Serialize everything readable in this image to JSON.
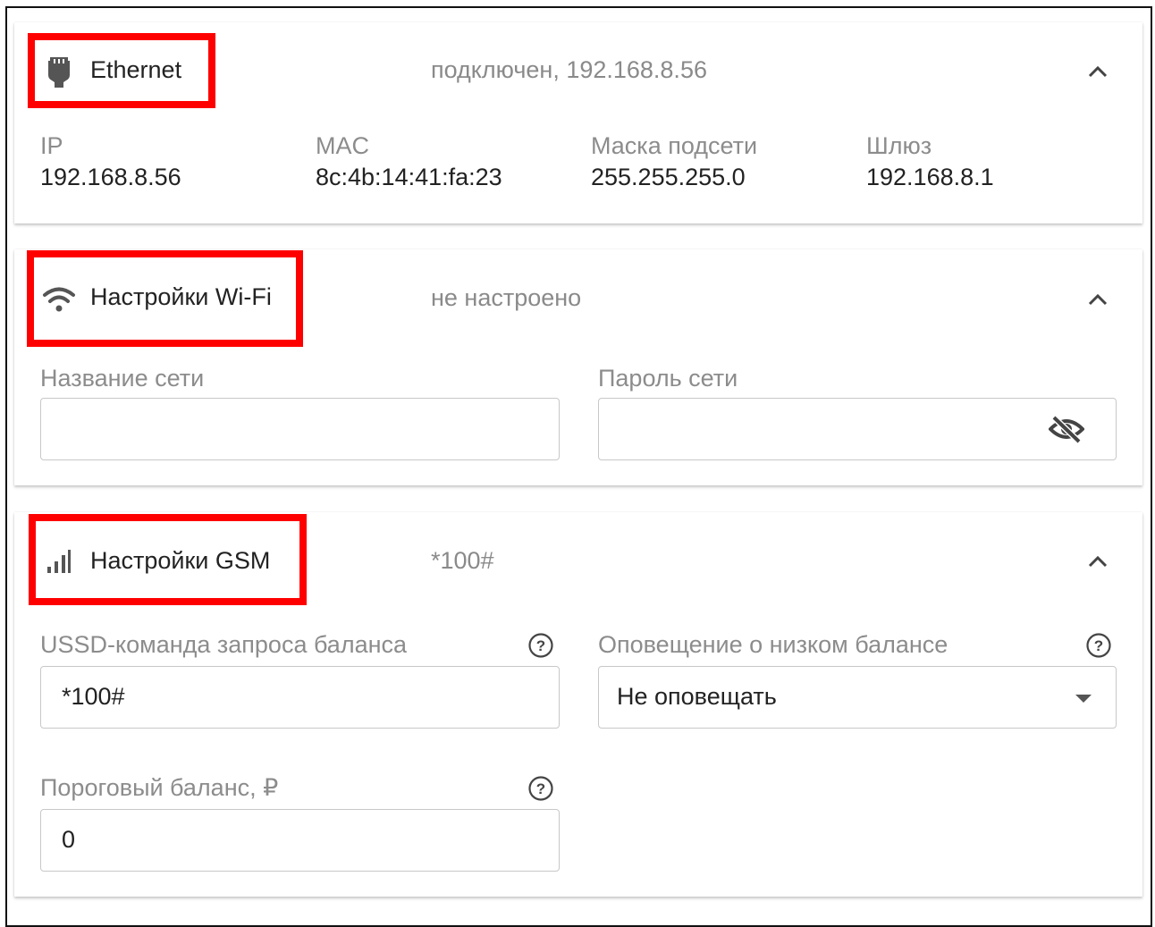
{
  "ethernet": {
    "title": "Ethernet",
    "status": "подключен, 192.168.8.56",
    "icon": "ethernet-plug-icon",
    "fields": [
      {
        "label": "IP",
        "value": "192.168.8.56"
      },
      {
        "label": "MAC",
        "value": "8c:4b:14:41:fa:23"
      },
      {
        "label": "Маска подсети",
        "value": "255.255.255.0"
      },
      {
        "label": "Шлюз",
        "value": "192.168.8.1"
      }
    ]
  },
  "wifi": {
    "title": "Настройки Wi-Fi",
    "status": "не настроено",
    "icon": "wifi-icon",
    "network_name_label": "Название сети",
    "network_name_value": "",
    "password_label": "Пароль сети",
    "password_value": "",
    "password_toggle_icon": "eye-off-icon"
  },
  "gsm": {
    "title": "Настройки GSM",
    "status": "*100#",
    "icon": "signal-bars-icon",
    "ussd_label": "USSD-команда запроса баланса",
    "ussd_value": "*100#",
    "alert_label": "Оповещение о низком балансе",
    "alert_selected": "Не оповещать",
    "threshold_label": "Пороговый баланс, ₽",
    "threshold_value": "0"
  },
  "colors": {
    "highlight": "#ff0000",
    "label": "#8c8c8c",
    "text": "#222222",
    "border": "#c8c8c8"
  }
}
